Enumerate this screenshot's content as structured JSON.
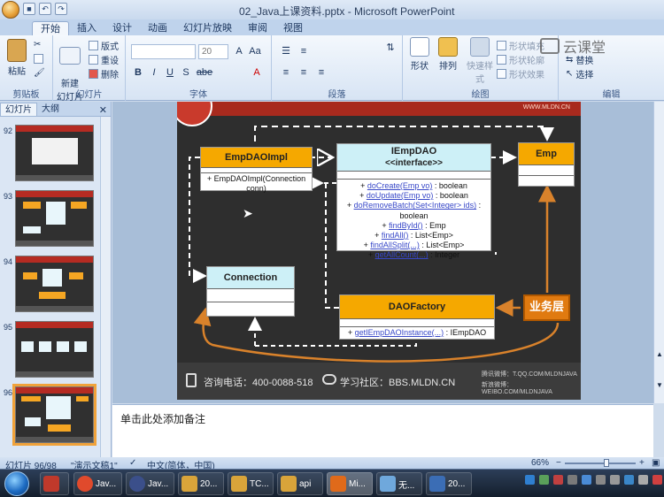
{
  "window": {
    "title": "02_Java上课资料.pptx - Microsoft PowerPoint"
  },
  "tabs": [
    "开始",
    "插入",
    "设计",
    "动画",
    "幻灯片放映",
    "审阅",
    "视图"
  ],
  "ribbon": {
    "clipboard": {
      "label": "剪贴板",
      "paste": "粘贴"
    },
    "slides": {
      "label": "幻灯片",
      "new_slide": "新建\n幻灯片",
      "layout": "版式",
      "reset": "重设",
      "delete": "删除"
    },
    "font": {
      "label": "字体",
      "size": "20",
      "buttons": [
        "B",
        "I",
        "U",
        "S",
        "abe",
        "A",
        "Aa",
        "A"
      ]
    },
    "paragraph": {
      "label": "段落"
    },
    "drawing": {
      "label": "绘图",
      "shapes": "形状",
      "arrange": "排列",
      "quick_styles": "快速样式",
      "fill": "形状填充",
      "outline": "形状轮廓",
      "effects": "形状效果"
    },
    "editing": {
      "label": "编辑",
      "replace": "替换",
      "select": "选择"
    }
  },
  "watermark": "云课堂",
  "left_panel": {
    "tabs": [
      "幻灯片",
      "大纲"
    ],
    "thumbs": [
      {
        "num": "92"
      },
      {
        "num": "93"
      },
      {
        "num": "94"
      },
      {
        "num": "95"
      },
      {
        "num": "96"
      }
    ]
  },
  "slide": {
    "header_right": "WWW.MLDN.CN",
    "dao_impl": {
      "title": "EmpDAOImpl",
      "op": "+ EmpDAOImpl(Connection conn)"
    },
    "iemp_dao": {
      "title": "IEmpDAO",
      "stereotype": "<<interface>>",
      "ops": [
        [
          "+ ",
          "doCreate(Emp vo)",
          " : boolean"
        ],
        [
          "+ ",
          "doUpdate(Emp vo)",
          " : boolean"
        ],
        [
          "+ ",
          "doRemoveBatch(Set<Integer> ids)",
          " : boolean"
        ],
        [
          "+ ",
          "findById()",
          " : Emp"
        ],
        [
          "+ ",
          "findAll()",
          " : List<Emp>"
        ],
        [
          "+ ",
          "findAllSplit(...)",
          " : List<Emp>"
        ],
        [
          "+ ",
          "getAllCount(...)",
          " : Integer"
        ]
      ]
    },
    "emp": {
      "title": "Emp"
    },
    "connection": {
      "title": "Connection"
    },
    "factory": {
      "title": "DAOFactory",
      "op_prefix": "+ ",
      "op_name": "getIEmpDAOInstance(...)",
      "op_type": " : IEmpDAO"
    },
    "business": "业务层",
    "footer": {
      "phone": "咨询电话：400-0088-518",
      "community": "学习社区：BBS.MLDN.CN",
      "weibo1": "腾讯微博：T.QQ.COM/MLDNJAVA",
      "weibo2": "新浪微博：WEIBO.COM/MLDNJAVA"
    }
  },
  "notes": {
    "placeholder": "单击此处添加备注"
  },
  "status": {
    "slide": "幻灯片 96/98",
    "theme": "\"演示文稿1\"",
    "lang": "中文(简体，中国)",
    "zoom": "66%",
    "zoom_level": 0.66
  },
  "taskbar": {
    "buttons": [
      {
        "label": "",
        "color": "#c0392b"
      },
      {
        "label": "Jav...",
        "color": "#e04a2c"
      },
      {
        "label": "Jav...",
        "color": "#3b4f8a"
      },
      {
        "label": "20...",
        "color": "#d9a43a"
      },
      {
        "label": "TC...",
        "color": "#d9a43a"
      },
      {
        "label": "api",
        "color": "#d9a43a"
      },
      {
        "label": "Mi...",
        "color": "#e06a1a"
      },
      {
        "label": "无...",
        "color": "#6fa8dc"
      },
      {
        "label": "20...",
        "color": "#3b6db5"
      }
    ]
  }
}
